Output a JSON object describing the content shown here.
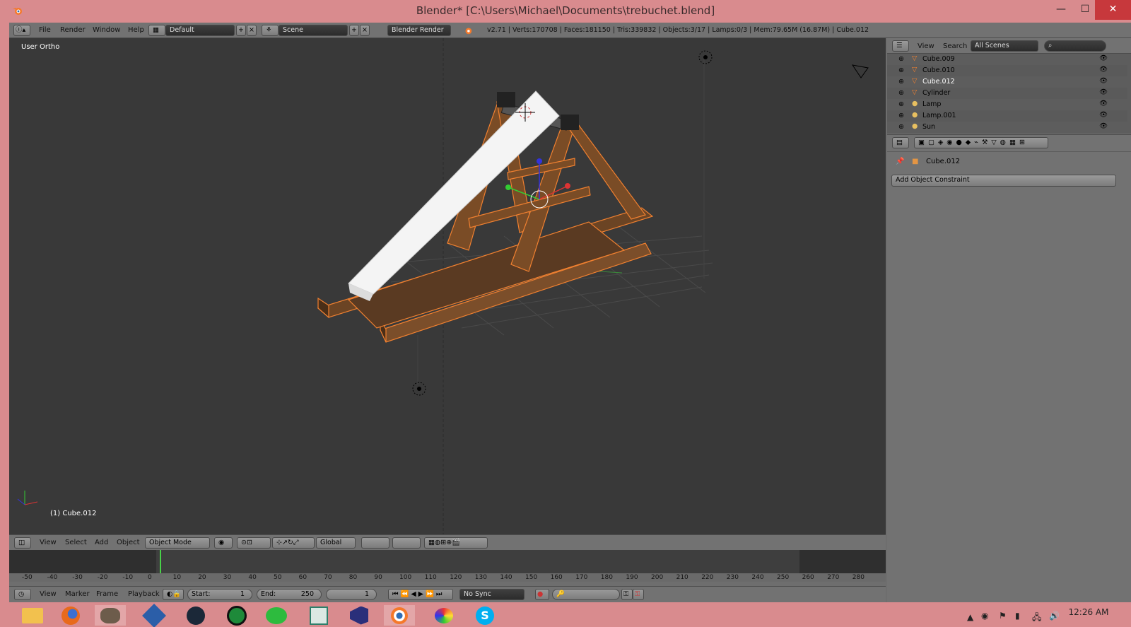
{
  "window": {
    "title": "Blender* [C:\\Users\\Michael\\Documents\\trebuchet.blend]",
    "min_label": "—",
    "max_label": "☐",
    "close_label": "✕"
  },
  "info_header": {
    "menus": [
      "File",
      "Render",
      "Window",
      "Help"
    ],
    "layout": "Default",
    "scene": "Scene",
    "engine": "Blender Render",
    "stats": "v2.71 | Verts:170708 | Faces:181150 | Tris:339832 | Objects:3/17 | Lamps:0/3 | Mem:79.65M (16.87M) | Cube.012"
  },
  "viewport": {
    "view_label": "User Ortho",
    "object_label": "(1) Cube.012"
  },
  "outliner": {
    "menus": [
      "View",
      "Search"
    ],
    "scene_filter": "All Scenes",
    "items": [
      {
        "name": "Cube.009",
        "icon": "mesh-icon",
        "selected": false
      },
      {
        "name": "Cube.010",
        "icon": "mesh-icon",
        "selected": false
      },
      {
        "name": "Cube.012",
        "icon": "mesh-icon",
        "selected": true
      },
      {
        "name": "Cylinder",
        "icon": "mesh-icon",
        "selected": false
      },
      {
        "name": "Lamp",
        "icon": "lamp-icon",
        "selected": false
      },
      {
        "name": "Lamp.001",
        "icon": "lamp-icon",
        "selected": false
      },
      {
        "name": "Sun",
        "icon": "lamp-icon",
        "selected": false
      }
    ]
  },
  "properties": {
    "object_name": "Cube.012",
    "add_constraint": "Add Object Constraint"
  },
  "view3d_header": {
    "menus": [
      "View",
      "Select",
      "Add",
      "Object"
    ],
    "mode": "Object Mode",
    "orientation": "Global"
  },
  "timeline": {
    "ticks": [
      "-50",
      "-40",
      "-30",
      "-20",
      "-10",
      "0",
      "10",
      "20",
      "30",
      "40",
      "50",
      "60",
      "70",
      "80",
      "90",
      "100",
      "110",
      "120",
      "130",
      "140",
      "150",
      "160",
      "170",
      "180",
      "190",
      "200",
      "210",
      "220",
      "230",
      "240",
      "250",
      "260",
      "270",
      "280"
    ],
    "menus": [
      "View",
      "Marker",
      "Frame",
      "Playback"
    ],
    "start_label": "Start:",
    "start_value": "1",
    "end_label": "End:",
    "end_value": "250",
    "current_frame": "1",
    "sync": "No Sync"
  },
  "taskbar": {
    "time": "12:26 AM",
    "apps": [
      "file-explorer-icon",
      "firefox-icon",
      "gimp-icon",
      "pen-app-icon",
      "steam-icon",
      "green-app-icon",
      "cloud-app-icon",
      "document-app-icon",
      "visual-studio-icon",
      "blender-icon",
      "paint-icon",
      "skype-icon"
    ]
  },
  "colors": {
    "chrome": "#d98b8e",
    "viewport_bg": "#393939",
    "selection_outline": "#f08030",
    "panel": "#727272"
  }
}
